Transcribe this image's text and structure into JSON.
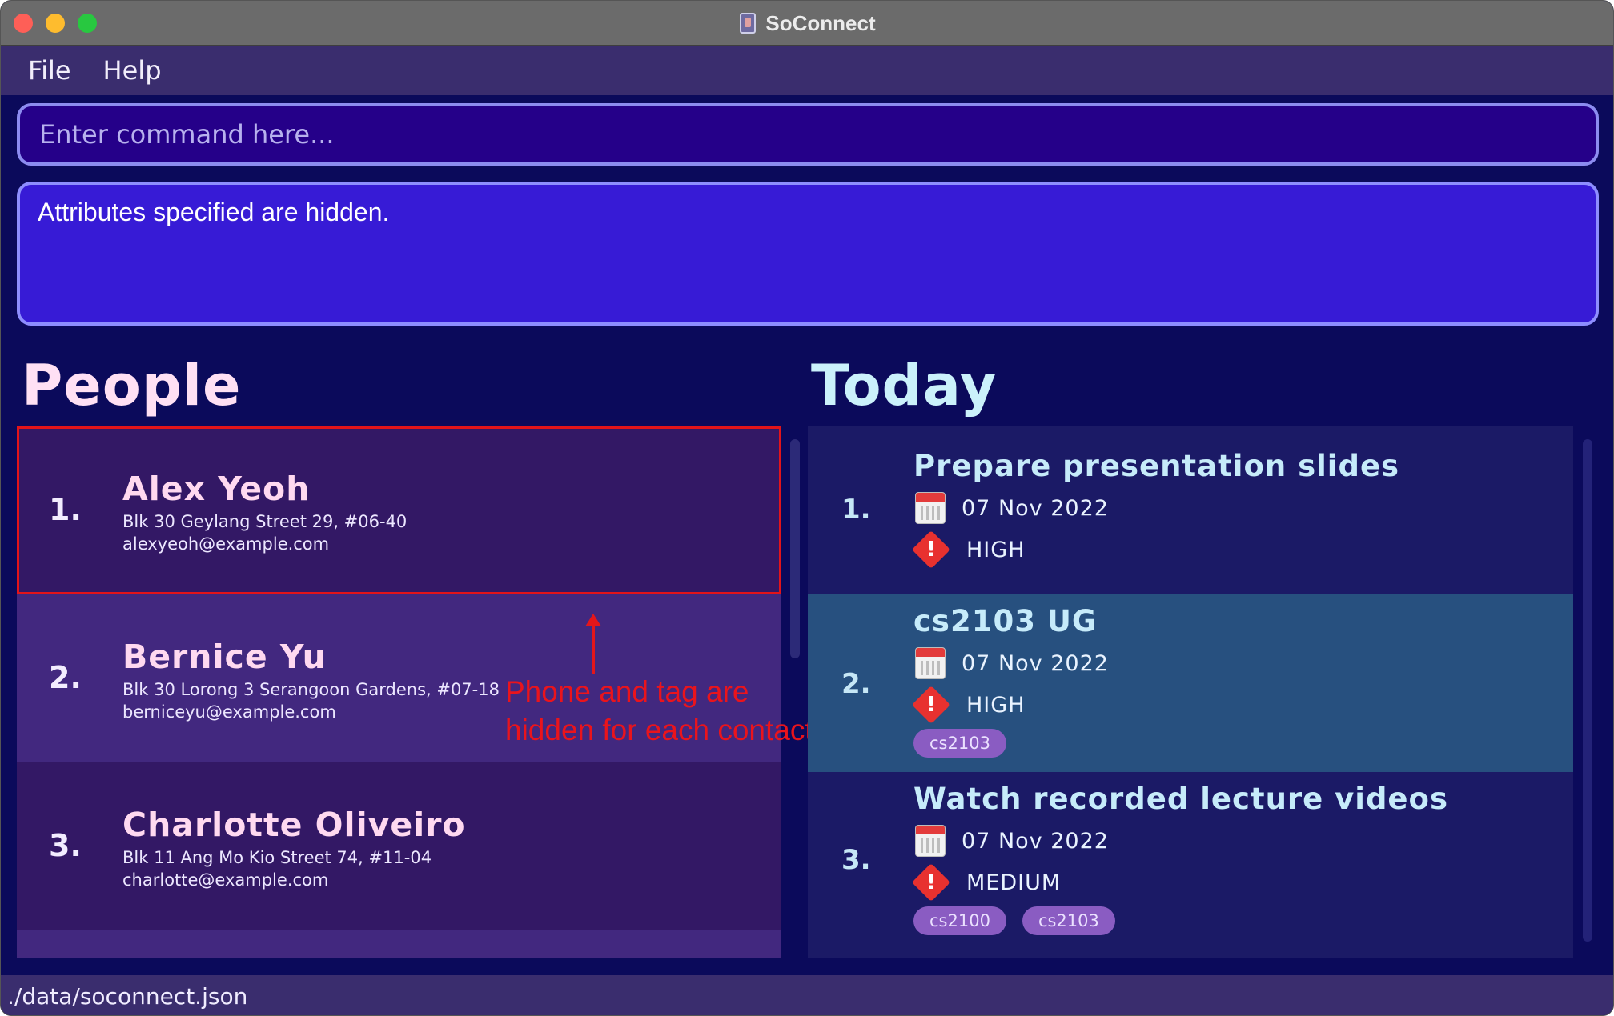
{
  "window": {
    "title": "SoConnect"
  },
  "menu": {
    "items": [
      "File",
      "Help"
    ]
  },
  "command": {
    "placeholder": "Enter command here..."
  },
  "result": {
    "text": "Attributes specified are hidden."
  },
  "people": {
    "heading": "People",
    "list": [
      {
        "index": "1.",
        "name": "Alex Yeoh",
        "address": "Blk 30 Geylang Street 29, #06-40",
        "email": "alexyeoh@example.com"
      },
      {
        "index": "2.",
        "name": "Bernice Yu",
        "address": "Blk 30 Lorong 3 Serangoon Gardens, #07-18",
        "email": "berniceyu@example.com"
      },
      {
        "index": "3.",
        "name": "Charlotte Oliveiro",
        "address": "Blk 11 Ang Mo Kio Street 74, #11-04",
        "email": "charlotte@example.com"
      }
    ]
  },
  "annotation": {
    "line1": "Phone and tag are",
    "line2": "hidden for each contact"
  },
  "today": {
    "heading": "Today",
    "tasks": [
      {
        "index": "1.",
        "name": "Prepare presentation slides",
        "date": "07 Nov 2022",
        "priority": "HIGH",
        "tags": []
      },
      {
        "index": "2.",
        "name": "cs2103 UG",
        "date": "07 Nov 2022",
        "priority": "HIGH",
        "tags": [
          "cs2103"
        ]
      },
      {
        "index": "3.",
        "name": "Watch recorded lecture videos",
        "date": "07 Nov 2022",
        "priority": "MEDIUM",
        "tags": [
          "cs2100",
          "cs2103"
        ]
      }
    ]
  },
  "status": {
    "path": "./data/soconnect.json"
  },
  "colors": {
    "background": "#0b0a5b",
    "command_bg": "#250089",
    "result_bg": "#371bd6",
    "annotation": "#e4161b",
    "selected_task": "#27507f"
  }
}
